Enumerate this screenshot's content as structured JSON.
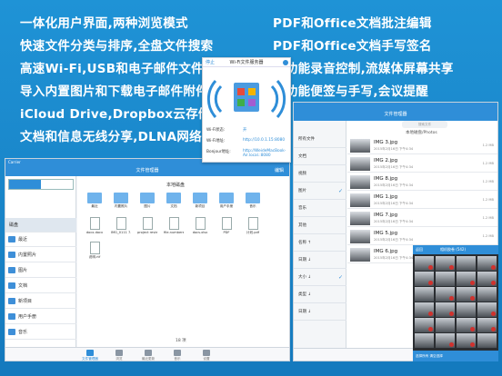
{
  "features_left": [
    "一体化用户界面,两种浏览模式",
    "快速文件分类与排序,全盘文件搜索",
    "高速Wi-Fi,USB和电子邮件文件传输",
    "导入内置图片和下载电子邮件附件",
    "iCloud Drive,Dropbox云存储",
    "文档和信息无线分享,DLNA网络共享"
  ],
  "features_right": [
    "PDF和Office文档批注编辑",
    "PDF和Office文档手写签名",
    "全功能录音控制,流媒体屏幕共享",
    "多功能便签与手写,会议提醒"
  ],
  "left_ipad": {
    "carrier": "Carrier",
    "title": "文件管理器",
    "edit": "编辑",
    "sidebar": {
      "section_label": "磁盘",
      "items": [
        "最近",
        "内置照片",
        "图片",
        "文档",
        "新项目",
        "用户手册",
        "音乐"
      ]
    },
    "main_title": "本地磁盘",
    "files": [
      {
        "label": "最近",
        "kind": "folder"
      },
      {
        "label": "内置照片",
        "kind": "folder"
      },
      {
        "label": "图片",
        "kind": "folder"
      },
      {
        "label": "文档",
        "kind": "folder"
      },
      {
        "label": "新项目",
        "kind": "folder"
      },
      {
        "label": "用户手册",
        "kind": "folder"
      },
      {
        "label": "音乐",
        "kind": "folder"
      },
      {
        "label": "docx.docx",
        "kind": "doc"
      },
      {
        "label": "IMG_0111 7.JPG",
        "kind": "doc"
      },
      {
        "label": "project review.ppt",
        "kind": "doc"
      },
      {
        "label": "file.numbers",
        "kind": "doc"
      },
      {
        "label": "docs.xlsx",
        "kind": "doc"
      },
      {
        "label": "PDF",
        "kind": "doc"
      },
      {
        "label": "计划.pdf",
        "kind": "doc"
      },
      {
        "label": "说明.rtf",
        "kind": "doc"
      }
    ],
    "count_label": "18 项",
    "tabs": [
      "文件管理器",
      "浏览",
      "最近更新",
      "音乐",
      "设置"
    ],
    "wifi_popup": {
      "stop": "停止",
      "title": "Wi-Fi文件服务器",
      "status_label": "Wi-Fi状态:",
      "status_value": "开",
      "address_label": "Wi-Fi地址:",
      "address_value": "http://10.0.1.15:8080",
      "bonjour_label": "Bonjour地址:",
      "bonjour_value": "http://WeideMacBook-Air.local.:8080"
    }
  },
  "right_ipad": {
    "title": "文件管理器",
    "search": "搜索文件",
    "list_header": "本地磁盘/Photos",
    "sidebar": [
      "所有文件",
      "文档",
      "视频",
      "图片",
      "音乐",
      "其他",
      "名称 ↑",
      "日期 ↓",
      "大小 ↓",
      "类型 ↓",
      "日期 ↓"
    ],
    "images": [
      {
        "name": "IMG 3.jpg",
        "date": "2015年2月16日 下午4:34",
        "size": "1.2 MB"
      },
      {
        "name": "IMG 2.jpg",
        "date": "2015年2月16日 下午4:34",
        "size": "1.2 MB"
      },
      {
        "name": "IMG 8.jpg",
        "date": "2015年2月16日 下午4:34",
        "size": "1.2 MB"
      },
      {
        "name": "IMG 1.jpg",
        "date": "2015年2月16日 下午4:34",
        "size": "1.2 MB"
      },
      {
        "name": "IMG 7.jpg",
        "date": "2015年2月16日 下午4:34",
        "size": "1.2 MB"
      },
      {
        "name": "IMG 5.jpg",
        "date": "2015年2月16日 下午4:34",
        "size": "1.2 MB"
      },
      {
        "name": "IMG 6.jpg",
        "date": "2015年2月16日 下午4:34",
        "size": "1.2 MB"
      }
    ],
    "photos_popup": {
      "back": "返回",
      "title": "相机胶卷 (542)",
      "footer": "选择所有 清空选择"
    }
  },
  "colors": {
    "brand_blue": "#2f8ed8",
    "background": "#1a86c8"
  }
}
